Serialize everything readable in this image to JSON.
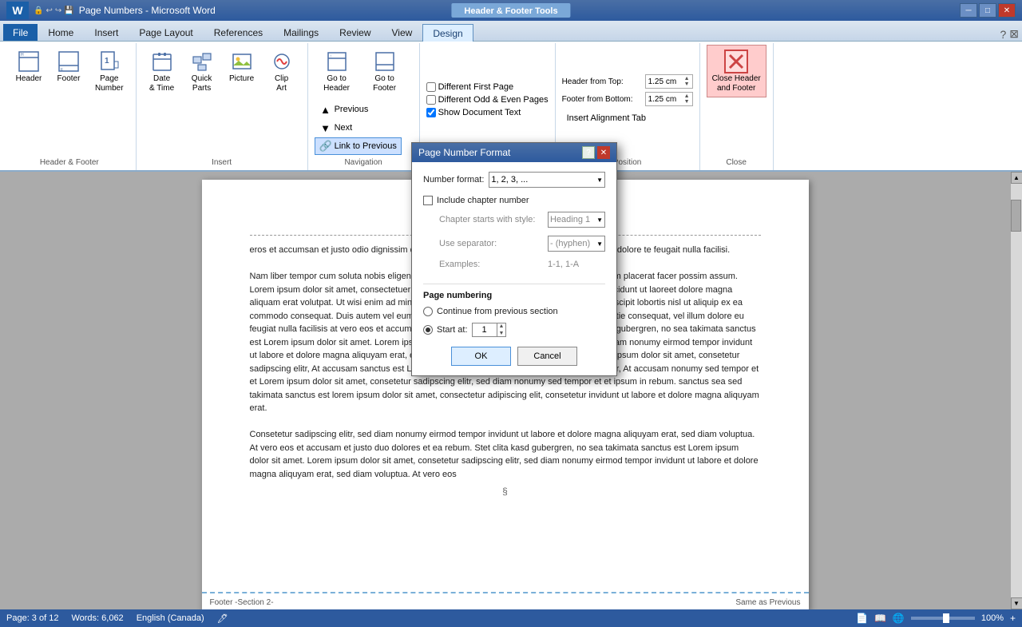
{
  "titlebar": {
    "title": "Page Numbers - Microsoft Word",
    "contextual_tab": "Header & Footer Tools",
    "win_min": "─",
    "win_restore": "□",
    "win_close": "✕"
  },
  "tabs": {
    "items": [
      "File",
      "Home",
      "Insert",
      "Page Layout",
      "References",
      "Mailings",
      "Review",
      "View"
    ],
    "contextual": "Design",
    "active": "Design"
  },
  "ribbon": {
    "groups": {
      "header_footer": {
        "label": "Header & Footer",
        "buttons": [
          "Header",
          "Footer",
          "Page\nNumber"
        ]
      },
      "insert": {
        "label": "Insert",
        "buttons": [
          "Date\n& Time",
          "Quick\nParts",
          "Picture",
          "Clip\nArt"
        ]
      },
      "navigation": {
        "label": "Navigation",
        "buttons": [
          "Go to\nHeader",
          "Go to\nFooter"
        ],
        "small_buttons": [
          "Previous",
          "Next",
          "Link to Previous"
        ]
      },
      "options": {
        "label": "Options",
        "checkboxes": [
          "Different First Page",
          "Different Odd & Even Pages",
          "Show Document Text"
        ]
      },
      "position": {
        "label": "Position",
        "header_from_top_label": "Header from Top:",
        "header_from_top_value": "1.25 cm",
        "footer_from_bottom_label": "Footer from Bottom:",
        "footer_from_bottom_value": "1.25 cm",
        "insert_alignment_tab": "Insert Alignment Tab"
      },
      "close": {
        "label": "Close",
        "button": "Close Header\nand Footer"
      }
    }
  },
  "dialog": {
    "title": "Page Number Format",
    "help_btn": "?",
    "close_btn": "✕",
    "number_format_label": "Number format:",
    "number_format_value": "1, 2, 3, ...",
    "include_chapter_label": "Include chapter number",
    "chapter_starts_label": "Chapter starts with style:",
    "chapter_starts_value": "Heading 1",
    "use_separator_label": "Use separator:",
    "use_separator_value": "- (hyphen)",
    "examples_label": "Examples:",
    "examples_value": "1-1, 1-A",
    "page_numbering_title": "Page numbering",
    "continue_label": "Continue from previous section",
    "start_at_label": "Start at:",
    "start_at_value": "1",
    "ok_label": "OK",
    "cancel_label": "Cancel"
  },
  "document": {
    "body_text": "eros et accumsan et justo odio dignissim qui blandit praesent luptatum zzril delenit augue duis dolore te feugait nulla facilisi.\n\nNam liber tempor cum soluta nobis eligend option congue nihil imperdiet doming id quod mazim placerat facer possim assum. Lorem ipsum dolor sit amet, consectetuer adipiscing elit, sed diam nonummy nibh euismod tincidunt ut laoreet dolore magna aliquam erat volutpat. Ut wisi enim ad minim veniam, quis nostrud exerci tation ullamcorper suscipit lobortis nisl ut aliquip ex ea commodo consequat. Duis autem vel eum iriure dolor in hendrerit in vulputate velit esse molestie consequat, vel illum dolore eu feugiat nulla facilisis at vero eros et accumsan et justo duo dolores et ea rebum. Stet clita kasd gubergren, no sea takimata sanctus est Lorem ipsum dolor sit amet. Lorem ipsum dolor sit amet, consetetur sadipscing elitr, sed diam nonumy eirmod tempor invidunt ut labore et dolore magna aliquyam erat, et accusam et justo duo dolores et ea rebum. Lorem ipsum dolor sit amet, consetetur sadipscing elitr, At accusam sanctus est Lorem ipsum dolor sit amet, consetetur sadipscing elitr, At accusam nonumy sed tempor et et Lorem ipsum dolor sit amet, consetetur sadipscing elitr, sed diam nonumy sed tempor et et ipsum in rebum. sanctus sea sed takimata sanctus est lorem ipsum dolor sit amet, consectetur adipiscing elit, consetetur invidunt ut labore et dolore magna aliquyam erat, sed diam voluptua.\n\nConsetetur sadipscing elitr, sed diam nonumy eirmod tempor invidunt ut labore et dolore magna aliquyam erat, sed diam voluptua. At vero eos et accusam et justo duo dolores et ea rebum. Stet clita kasd gubergren, no sea takimata sanctus est Lorem ipsum dolor sit amet. Lorem ipsum dolor sit amet, consetetur sadipscing elitr, sed diam nonumy eirmod tempor invidunt ut labore et dolore magna aliquyam erat, sed diam voluptua. At vero eos",
    "footer_label": "Footer -Section 2-",
    "footer_right": "Same as Previous",
    "page_cursor": "§"
  },
  "statusbar": {
    "page": "Page: 3 of 12",
    "words": "Words: 6,062",
    "language": "English (Canada)",
    "zoom": "100%"
  }
}
